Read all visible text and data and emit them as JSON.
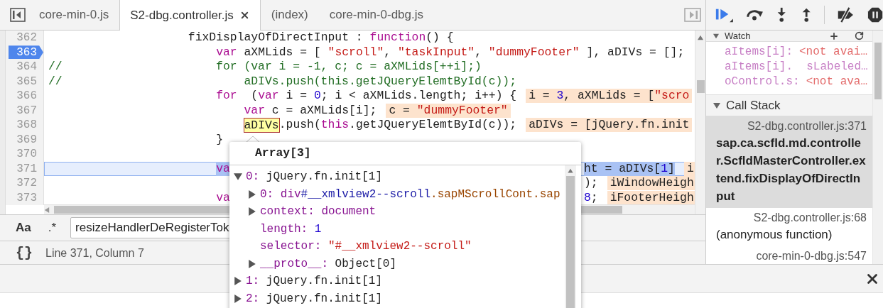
{
  "tabs": [
    {
      "label": "core-min-0.js",
      "selected": false,
      "closable": false
    },
    {
      "label": "S2-dbg.controller.js",
      "selected": true,
      "closable": true
    },
    {
      "label": "(index)",
      "selected": false,
      "closable": false
    },
    {
      "label": "core-min-0-dbg.js",
      "selected": false,
      "closable": false
    }
  ],
  "editor": {
    "lines": [
      {
        "number": "362",
        "breakpoint": false,
        "current": false,
        "spans": [
          {
            "text": "                    fixDisplayOfDirectInput : ",
            "kind": "plain"
          },
          {
            "text": "function",
            "kind": "keyword"
          },
          {
            "text": "() {",
            "kind": "plain"
          }
        ]
      },
      {
        "number": "363",
        "breakpoint": true,
        "current": false,
        "spans": [
          {
            "text": "                        var",
            "kind": "keyword"
          },
          {
            "text": " aXMLids = [ ",
            "kind": "plain"
          },
          {
            "text": "\"scroll\"",
            "kind": "string"
          },
          {
            "text": ", ",
            "kind": "plain"
          },
          {
            "text": "\"taskInput\"",
            "kind": "string"
          },
          {
            "text": ", ",
            "kind": "plain"
          },
          {
            "text": "\"dummyFooter\"",
            "kind": "string"
          },
          {
            "text": " ], aDIVs = [];",
            "kind": "plain"
          }
        ]
      },
      {
        "number": "364",
        "breakpoint": false,
        "current": false,
        "spans": [
          {
            "text": "//                      for (var i = -1, c; c = aXMLids[++i];)",
            "kind": "comment"
          }
        ]
      },
      {
        "number": "365",
        "breakpoint": false,
        "current": false,
        "spans": [
          {
            "text": "//                          aDIVs.push(this.getJQueryElemtById(c));",
            "kind": "comment"
          }
        ]
      },
      {
        "number": "366",
        "breakpoint": false,
        "current": false,
        "spans": [
          {
            "text": "                        for",
            "kind": "keyword"
          },
          {
            "text": "  (",
            "kind": "plain"
          },
          {
            "text": "var",
            "kind": "keyword"
          },
          {
            "text": " i = ",
            "kind": "plain"
          },
          {
            "text": "0",
            "kind": "number"
          },
          {
            "text": "; i < aXMLids.length; i++) {",
            "kind": "plain"
          }
        ],
        "annotation": [
          {
            "text": "i = ",
            "kind": "plain"
          },
          {
            "text": "3",
            "kind": "number"
          },
          {
            "text": ", aXMLids = [",
            "kind": "plain"
          },
          {
            "text": "\"scro",
            "kind": "string"
          }
        ]
      },
      {
        "number": "367",
        "breakpoint": false,
        "current": false,
        "spans": [
          {
            "text": "                            var",
            "kind": "keyword"
          },
          {
            "text": " c = aXMLids[i];",
            "kind": "plain"
          }
        ],
        "annotation": [
          {
            "text": "c = ",
            "kind": "plain"
          },
          {
            "text": "\"dummyFooter\"",
            "kind": "string"
          }
        ]
      },
      {
        "number": "368",
        "breakpoint": false,
        "current": false,
        "spans": [
          {
            "text": "                            aDIVs",
            "kind": "hover"
          },
          {
            "text": ".push(",
            "kind": "plain"
          },
          {
            "text": "this",
            "kind": "keyword"
          },
          {
            "text": ".getJQueryElemtById(c));",
            "kind": "plain"
          }
        ],
        "annotation": [
          {
            "text": "aDIVs = [jQuery.fn.init",
            "kind": "plain"
          }
        ]
      },
      {
        "number": "369",
        "breakpoint": false,
        "current": false,
        "spans": [
          {
            "text": "                        }",
            "kind": "plain"
          }
        ]
      },
      {
        "number": "370",
        "breakpoint": false,
        "current": false
      },
      {
        "number": "371",
        "breakpoint": false,
        "current": true,
        "spans": [
          {
            "text": "                        va",
            "kind": "keyword"
          }
        ],
        "after_popup": {
          "spans": [
            {
              "text": "ht = aDIVs[",
              "kind": "plain"
            },
            {
              "text": "1",
              "kind": "number"
            },
            {
              "text": "]",
              "kind": "plain"
            }
          ],
          "annotation": [
            {
              "text": "i",
              "kind": "plain"
            }
          ]
        }
      },
      {
        "number": "372",
        "breakpoint": false,
        "current": false,
        "after_popup": {
          "spans": [
            {
              "text": ");",
              "kind": "plain"
            }
          ],
          "annotation": [
            {
              "text": "iWindowHeigh",
              "kind": "plain"
            }
          ]
        }
      },
      {
        "number": "373",
        "breakpoint": false,
        "current": false,
        "spans": [
          {
            "text": "                        va",
            "kind": "keyword"
          }
        ],
        "after_popup": {
          "spans": [
            {
              "text": "8",
              "kind": "number"
            },
            {
              "text": ";",
              "kind": "plain"
            }
          ],
          "annotation": [
            {
              "text": "iFooterHeigh",
              "kind": "plain"
            }
          ]
        }
      }
    ]
  },
  "search": {
    "case_toggle": "Aa",
    "regex_toggle": ".*",
    "query": "resizeHandlerDeRegisterTok"
  },
  "status_bar": {
    "format_toggle": "{}",
    "position": "Line 371, Column 7"
  },
  "popover": {
    "title": "Array[3]",
    "nodes": [
      {
        "name": "0:",
        "value": [
          {
            "text": "jQuery.fn.init[1]",
            "kind": "object"
          }
        ],
        "expanded": true,
        "children": [
          {
            "name": "0:",
            "value": [
              {
                "text": "div",
                "kind": "tag"
              },
              {
                "text": "#__xmlview2--scroll",
                "kind": "id"
              },
              {
                "text": ".sapMScrollCont.sap",
                "kind": "class"
              }
            ],
            "expanded": false
          },
          {
            "name": "context:",
            "value": [
              {
                "text": "document",
                "kind": "tag"
              }
            ],
            "expanded": false
          },
          {
            "name": "length:",
            "value": [
              {
                "text": "1",
                "kind": "number"
              }
            ]
          },
          {
            "name": "selector:",
            "value": [
              {
                "text": "\"#__xmlview2--scroll\"",
                "kind": "string"
              }
            ]
          },
          {
            "name": "__proto__:",
            "value": [
              {
                "text": "Object[0]",
                "kind": "object"
              }
            ],
            "expanded": false
          }
        ]
      },
      {
        "name": "1:",
        "value": [
          {
            "text": "jQuery.fn.init[1]",
            "kind": "object"
          }
        ],
        "expanded": false
      },
      {
        "name": "2:",
        "value": [
          {
            "text": "jQuery.fn.init[1]",
            "kind": "object"
          }
        ],
        "expanded": false
      }
    ]
  },
  "watch": {
    "title": "Watch",
    "expressions": [
      {
        "name": "aItems[i]:",
        "value": "<not avai…"
      },
      {
        "name": "aItems[i].  sLabeled…"
      },
      {
        "name": "oControl.s:",
        "value": "<not ava…"
      }
    ]
  },
  "call_stack": {
    "title": "Call Stack",
    "frames": [
      {
        "location": "S2-dbg.controller.js:371",
        "function": "sap.ca.scfld.md.controller.ScfldMasterController.extend.fixDisplayOfDirectInput",
        "selected": true
      },
      {
        "location": "S2-dbg.controller.js:68",
        "function": "(anonymous function)",
        "selected": false
      },
      {
        "location": "core-min-0-dbg.js:547",
        "selected": false
      }
    ]
  }
}
